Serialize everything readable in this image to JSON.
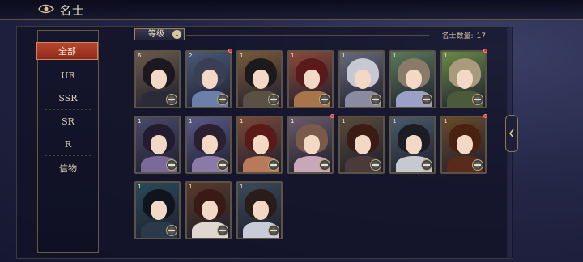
{
  "header": {
    "title": "名士"
  },
  "sidebar": {
    "items": [
      {
        "label": "全部",
        "active": true
      },
      {
        "label": "UR"
      },
      {
        "label": "SSR"
      },
      {
        "label": "SR"
      },
      {
        "label": "R"
      },
      {
        "label": "信物"
      }
    ]
  },
  "toolbar": {
    "sort_label": "等级",
    "count_label": "名士数量:",
    "count_value": "17"
  },
  "cards": [
    {
      "name": "card-1",
      "level": "6",
      "bg": "#6b5a4a",
      "hair": "#1b1820",
      "body": "#2b2a38",
      "dot": false
    },
    {
      "name": "card-2",
      "level": "2",
      "bg": "#4a5a78",
      "hair": "#3a3f55",
      "body": "#6b7fa8",
      "dot": true
    },
    {
      "name": "card-3",
      "level": "1",
      "bg": "#7a5a3a",
      "hair": "#1c1a1a",
      "body": "#5a5046",
      "dot": false
    },
    {
      "name": "card-4",
      "level": "1",
      "bg": "#8a4a3a",
      "hair": "#5a1a1c",
      "body": "#a8744a",
      "dot": false
    },
    {
      "name": "card-5",
      "level": "1",
      "bg": "#6a6a7a",
      "hair": "#c8c8d4",
      "body": "#8a8aa0",
      "dot": false
    },
    {
      "name": "card-6",
      "level": "1",
      "bg": "#5a7a5a",
      "hair": "#8a7a6a",
      "body": "#9aa0c8",
      "dot": false
    },
    {
      "name": "card-7",
      "level": "1",
      "bg": "#6a8a4a",
      "hair": "#a89a7a",
      "body": "#4a5a3a",
      "dot": true
    },
    {
      "name": "card-8",
      "level": "1",
      "bg": "#4a4a6a",
      "hair": "#231c30",
      "body": "#7a6a9a",
      "dot": false
    },
    {
      "name": "card-9",
      "level": "1",
      "bg": "#5a5a8a",
      "hair": "#2a2030",
      "body": "#8a7aa8",
      "dot": false
    },
    {
      "name": "card-10",
      "level": "1",
      "bg": "#7a4a3a",
      "hair": "#5a1a18",
      "body": "#b87a5a",
      "dot": false
    },
    {
      "name": "card-11",
      "level": "1",
      "bg": "#6a5a6a",
      "hair": "#7a5a4a",
      "body": "#c8a8b8",
      "dot": true
    },
    {
      "name": "card-12",
      "level": "1",
      "bg": "#5a4a3a",
      "hair": "#3a1c14",
      "body": "#4a3a3a",
      "dot": false
    },
    {
      "name": "card-13",
      "level": "1",
      "bg": "#4a5a6a",
      "hair": "#1c1c24",
      "body": "#c8c8d0",
      "dot": false
    },
    {
      "name": "card-14",
      "level": "1",
      "bg": "#6a4a2a",
      "hair": "#4a2010",
      "body": "#5a2a1a",
      "dot": true
    },
    {
      "name": "card-15",
      "level": "1",
      "bg": "#2a4a5a",
      "hair": "#10141c",
      "body": "#2a3a4a",
      "dot": false
    },
    {
      "name": "card-16",
      "level": "1",
      "bg": "#5a3a2a",
      "hair": "#3a1a14",
      "body": "#e0d8d0",
      "dot": false
    },
    {
      "name": "card-17",
      "level": "1",
      "bg": "#3a4a5a",
      "hair": "#2a1c18",
      "body": "#c8ccd8",
      "dot": false
    }
  ]
}
